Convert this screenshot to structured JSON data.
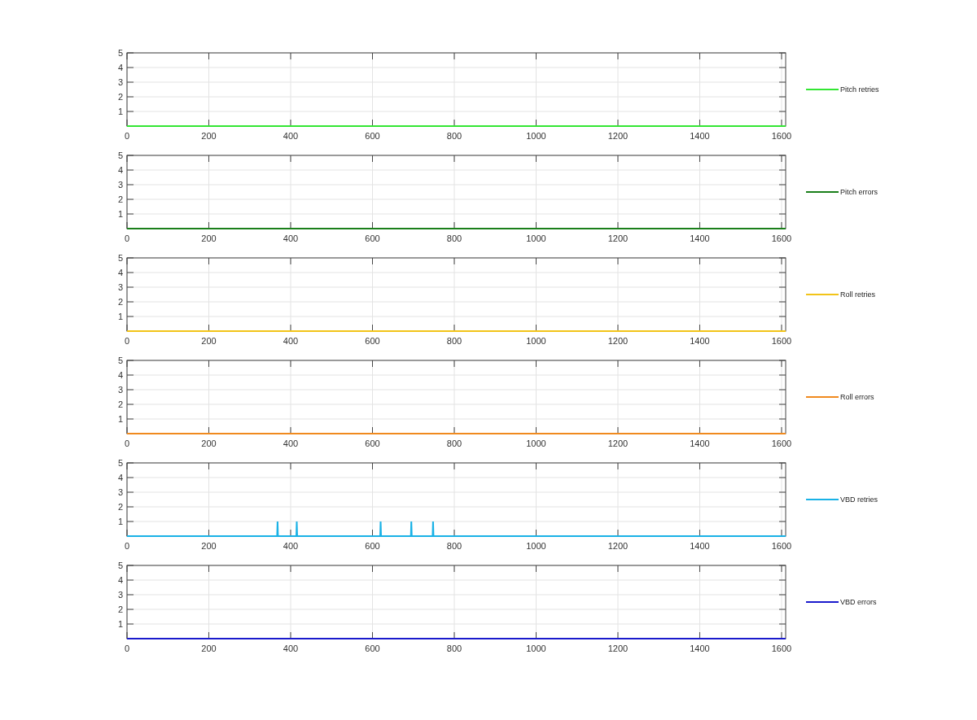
{
  "charts": [
    {
      "chart_data": {
        "type": "line",
        "x": [
          0,
          1610
        ],
        "series": [
          {
            "name": "Pitch retries",
            "color": "#33e633",
            "values": [
              0,
              0
            ]
          }
        ],
        "xlim": [
          0,
          1610
        ],
        "ylim": [
          0,
          5
        ],
        "xticks": [
          0,
          200,
          400,
          600,
          800,
          1000,
          1200,
          1400,
          1600
        ],
        "yticks": [
          1,
          2,
          3,
          4,
          5
        ],
        "grid": true
      }
    },
    {
      "chart_data": {
        "type": "line",
        "x": [
          0,
          1610
        ],
        "series": [
          {
            "name": "Pitch errors",
            "color": "#1a7f1a",
            "values": [
              0,
              0
            ]
          }
        ],
        "xlim": [
          0,
          1610
        ],
        "ylim": [
          0,
          5
        ],
        "xticks": [
          0,
          200,
          400,
          600,
          800,
          1000,
          1200,
          1400,
          1600
        ],
        "yticks": [
          1,
          2,
          3,
          4,
          5
        ],
        "grid": true
      }
    },
    {
      "chart_data": {
        "type": "line",
        "x": [
          0,
          1610
        ],
        "series": [
          {
            "name": "Roll retries",
            "color": "#f2c419",
            "values": [
              0,
              0
            ]
          }
        ],
        "xlim": [
          0,
          1610
        ],
        "ylim": [
          0,
          5
        ],
        "xticks": [
          0,
          200,
          400,
          600,
          800,
          1000,
          1200,
          1400,
          1600
        ],
        "yticks": [
          1,
          2,
          3,
          4,
          5
        ],
        "grid": true
      }
    },
    {
      "chart_data": {
        "type": "line",
        "x": [
          0,
          1610
        ],
        "series": [
          {
            "name": "Roll errors",
            "color": "#f08a1e",
            "values": [
              0,
              0
            ]
          }
        ],
        "xlim": [
          0,
          1610
        ],
        "ylim": [
          0,
          5
        ],
        "xticks": [
          0,
          200,
          400,
          600,
          800,
          1000,
          1200,
          1400,
          1600
        ],
        "yticks": [
          1,
          2,
          3,
          4,
          5
        ],
        "grid": true
      }
    },
    {
      "chart_data": {
        "type": "line",
        "x": [
          0,
          367,
          368,
          369,
          414,
          415,
          416,
          619,
          620,
          621,
          694,
          695,
          696,
          747,
          748,
          749,
          1610
        ],
        "series": [
          {
            "name": "VBD retries",
            "color": "#1ab2e6",
            "values": [
              0,
              0,
              1,
              0,
              0,
              1,
              0,
              0,
              1,
              0,
              0,
              1,
              0,
              0,
              1,
              0,
              0
            ]
          }
        ],
        "xlim": [
          0,
          1610
        ],
        "ylim": [
          0,
          5
        ],
        "xticks": [
          0,
          200,
          400,
          600,
          800,
          1000,
          1200,
          1400,
          1600
        ],
        "yticks": [
          1,
          2,
          3,
          4,
          5
        ],
        "grid": true
      }
    },
    {
      "chart_data": {
        "type": "line",
        "x": [
          0,
          1610
        ],
        "series": [
          {
            "name": "VBD errors",
            "color": "#1a1acc",
            "values": [
              0,
              0
            ]
          }
        ],
        "xlim": [
          0,
          1610
        ],
        "ylim": [
          0,
          5
        ],
        "xticks": [
          0,
          200,
          400,
          600,
          800,
          1000,
          1200,
          1400,
          1600
        ],
        "yticks": [
          1,
          2,
          3,
          4,
          5
        ],
        "grid": true
      }
    }
  ]
}
